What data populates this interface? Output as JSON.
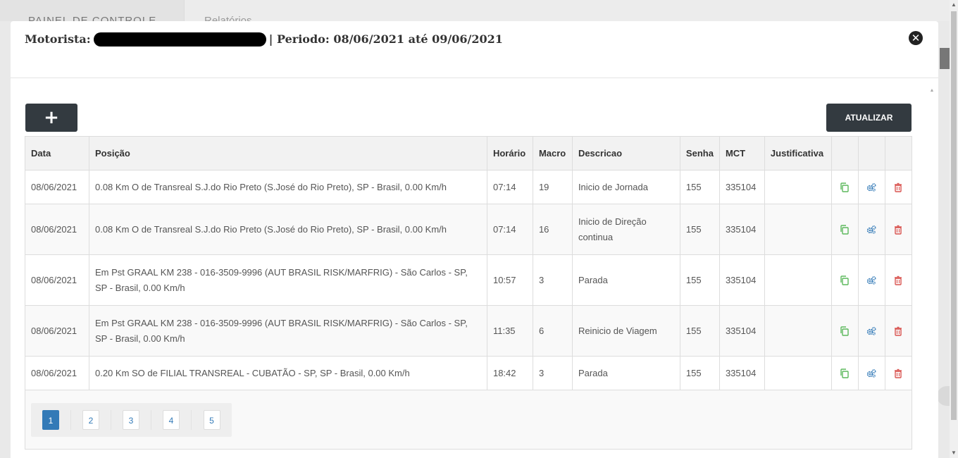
{
  "background": {
    "side_label": "PAINEL DE CONTROLE",
    "tab_label": "Relatórios"
  },
  "modal": {
    "title_prefix": "Motorista:",
    "title_suffix": "| Periodo: 08/06/2021 até 09/06/2021",
    "close_icon": "close-circle-icon"
  },
  "toolbar": {
    "add_label": "+",
    "refresh_label": "ATUALIZAR"
  },
  "table": {
    "headers": [
      "Data",
      "Posição",
      "Horário",
      "Macro",
      "Descricao",
      "Senha",
      "MCT",
      "Justificativa",
      "",
      "",
      ""
    ],
    "rows": [
      {
        "data": "08/06/2021",
        "posicao": "0.08 Km O de Transreal S.J.do Rio Preto (S.José do Rio Preto), SP - Brasil, 0.00 Km/h",
        "horario": "07:14",
        "macro": "19",
        "descricao": "Inicio de Jornada",
        "senha": "155",
        "mct": "335104",
        "justificativa": ""
      },
      {
        "data": "08/06/2021",
        "posicao": "0.08 Km O de Transreal S.J.do Rio Preto (S.José do Rio Preto), SP - Brasil, 0.00 Km/h",
        "horario": "07:14",
        "macro": "16",
        "descricao": "Inicio de Direção continua",
        "senha": "155",
        "mct": "335104",
        "justificativa": ""
      },
      {
        "data": "08/06/2021",
        "posicao": "Em Pst GRAAL KM 238 - 016-3509-9996 (AUT BRASIL RISK/MARFRIG) - São Carlos - SP, SP - Brasil, 0.00 Km/h",
        "horario": "10:57",
        "macro": "3",
        "descricao": "Parada",
        "senha": "155",
        "mct": "335104",
        "justificativa": ""
      },
      {
        "data": "08/06/2021",
        "posicao": "Em Pst GRAAL KM 238 - 016-3509-9996 (AUT BRASIL RISK/MARFRIG) - São Carlos - SP, SP - Brasil, 0.00 Km/h",
        "horario": "11:35",
        "macro": "6",
        "descricao": "Reinicio de Viagem",
        "senha": "155",
        "mct": "335104",
        "justificativa": ""
      },
      {
        "data": "08/06/2021",
        "posicao": "0.20 Km SO de FILIAL TRANSREAL - CUBATÃO - SP, SP - Brasil, 0.00 Km/h",
        "horario": "18:42",
        "macro": "3",
        "descricao": "Parada",
        "senha": "155",
        "mct": "335104",
        "justificativa": ""
      }
    ],
    "row_actions": [
      "copy-icon",
      "settings-gears-icon",
      "trash-icon"
    ]
  },
  "pagination": {
    "pages": [
      "1",
      "2",
      "3",
      "4",
      "5"
    ],
    "active": "1"
  },
  "colors": {
    "button_dark": "#333a40",
    "copy_icon": "#5cb85c",
    "gears_icon": "#337ab7",
    "trash_icon": "#d9534f",
    "pager_active": "#337ab7"
  }
}
